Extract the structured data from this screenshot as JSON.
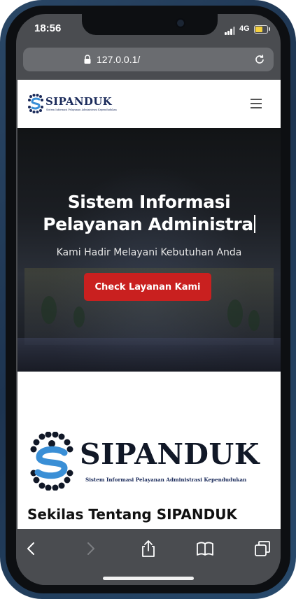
{
  "status_bar": {
    "time": "18:56",
    "network": "4G",
    "battery_fill_fraction": 0.65,
    "battery_color": "#f4d03f"
  },
  "browser": {
    "url": "127.0.0.1/",
    "icons": {
      "lock": "lock-icon",
      "reload": "reload-icon",
      "back": "back-icon",
      "forward": "forward-icon",
      "share": "share-icon",
      "bookmarks": "book-icon",
      "tabs": "tabs-icon"
    }
  },
  "navbar": {
    "logo_text": "SIPANDUK",
    "logo_subtitle": "Sistem Informasi Pelayanan Administrasi Kependudukan",
    "menu_icon": "hamburger-menu-icon"
  },
  "hero": {
    "title_line1": "Sistem Informasi",
    "title_line2": "Pelayanan Administra",
    "subtitle": "Kami Hadir Melayani Kebutuhan Anda",
    "button_label": "Check Layanan Kami",
    "button_color": "#c9201f"
  },
  "about": {
    "logo_text": "SIPANDUK",
    "logo_subtitle": "Sistem Informasi Pelayanan Administrasi Kependudukan",
    "heading": "Sekilas Tentang SIPANDUK"
  },
  "colors": {
    "brand_navy": "#1a2a5a",
    "brand_blue": "#3a8fd6",
    "browser_chrome": "#4a4c50"
  }
}
